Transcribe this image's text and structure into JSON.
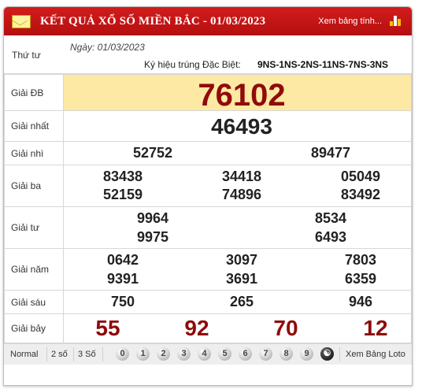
{
  "header": {
    "title": "KẾT QUẢ XỔ SỐ MIỀN BẮC - 01/03/2023",
    "view_table_link": "Xem bảng tính...",
    "header_bg": "#c41616"
  },
  "info": {
    "weekday": "Thứ tư",
    "date": "Ngày: 01/03/2023",
    "special_code_label": "Ký hiệu trúng Đặc Biệt:",
    "special_code_value": "9NS-1NS-2NS-11NS-7NS-3NS"
  },
  "prizes": {
    "db": {
      "label": "Giải ĐB",
      "numbers": [
        "76102"
      ]
    },
    "nhat": {
      "label": "Giải nhất",
      "numbers": [
        "46493"
      ]
    },
    "nhi": {
      "label": "Giải nhì",
      "numbers": [
        "52752",
        "89477"
      ]
    },
    "ba": {
      "label": "Giải ba",
      "numbers": [
        "83438",
        "34418",
        "05049",
        "52159",
        "74896",
        "83492"
      ]
    },
    "tu": {
      "label": "Giải tư",
      "numbers": [
        "9964",
        "8534",
        "9975",
        "6493"
      ]
    },
    "nam": {
      "label": "Giải năm",
      "numbers": [
        "0642",
        "3097",
        "7803",
        "9391",
        "3691",
        "6359"
      ]
    },
    "sau": {
      "label": "Giải sáu",
      "numbers": [
        "750",
        "265",
        "946"
      ]
    },
    "bay": {
      "label": "Giải bảy",
      "numbers": [
        "55",
        "92",
        "70",
        "12"
      ]
    }
  },
  "footer": {
    "modes": [
      "Normal",
      "2 số",
      "3 Số"
    ],
    "digits": [
      "0",
      "1",
      "2",
      "3",
      "4",
      "5",
      "6",
      "7",
      "8",
      "9"
    ],
    "loto_link": "Xem Bảng Loto"
  },
  "colors": {
    "special_row_bg": "#fde9a3",
    "red_number": "#8e0b0b"
  }
}
